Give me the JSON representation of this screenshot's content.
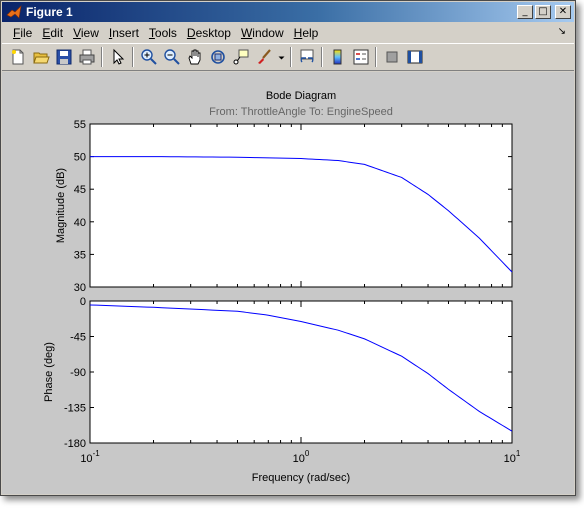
{
  "window": {
    "title": "Figure 1",
    "minimize_glyph": "_",
    "maximize_glyph": "□",
    "close_glyph": "✕"
  },
  "menubar": {
    "items": [
      {
        "label": "File",
        "accel": "F",
        "rest": "ile"
      },
      {
        "label": "Edit",
        "accel": "E",
        "rest": "dit"
      },
      {
        "label": "View",
        "accel": "V",
        "rest": "iew"
      },
      {
        "label": "Insert",
        "accel": "I",
        "rest": "nsert"
      },
      {
        "label": "Tools",
        "accel": "T",
        "rest": "ools"
      },
      {
        "label": "Desktop",
        "accel": "D",
        "rest": "esktop"
      },
      {
        "label": "Window",
        "accel": "W",
        "rest": "indow"
      },
      {
        "label": "Help",
        "accel": "H",
        "rest": "elp"
      }
    ],
    "dock_glyph": "↘"
  },
  "toolbar": {
    "tools": [
      "new-figure-icon",
      "open-file-icon",
      "save-icon",
      "print-icon",
      "edit-plot-arrow-icon",
      "zoom-in-icon",
      "zoom-out-icon",
      "pan-hand-icon",
      "rotate-3d-icon",
      "data-cursor-icon",
      "brush-icon",
      "dropdown-arrow-icon",
      "link-plot-icon",
      "insert-colorbar-icon",
      "insert-legend-icon",
      "hide-plot-tools-icon",
      "show-plot-tools-icon"
    ]
  },
  "colors": {
    "title_start": "#0a246a",
    "figure_bg": "#c8c8c8",
    "axes_bg": "#ffffff",
    "line": "#0000ff",
    "subtitle": "#666666"
  },
  "chart_data": [
    {
      "type": "line",
      "title": "Bode Diagram",
      "subtitle": "From: ThrottleAngle  To: EngineSpeed",
      "xlabel": "",
      "ylabel": "Magnitude (dB)",
      "xscale": "log",
      "xlim": [
        0.1,
        10
      ],
      "ylim": [
        30,
        55
      ],
      "yticks": [
        30,
        35,
        40,
        45,
        50,
        55
      ],
      "grid": false,
      "series": [
        {
          "x": [
            0.1,
            0.2,
            0.5,
            1.0,
            1.5,
            2.0,
            3.0,
            4.0,
            5.0,
            7.0,
            10.0
          ],
          "y": [
            50.0,
            50.0,
            49.9,
            49.7,
            49.4,
            48.8,
            46.8,
            44.2,
            41.7,
            37.5,
            32.3
          ]
        }
      ]
    },
    {
      "type": "line",
      "xlabel": "Frequency  (rad/sec)",
      "ylabel": "Phase (deg)",
      "xscale": "log",
      "xlim": [
        0.1,
        10
      ],
      "ylim": [
        -180,
        0
      ],
      "yticks": [
        0,
        -45,
        -90,
        -135,
        -180
      ],
      "xticks": [
        0.1,
        1,
        10
      ],
      "xtick_labels": [
        {
          "base": "10",
          "exp": "-1"
        },
        {
          "base": "10",
          "exp": "0"
        },
        {
          "base": "10",
          "exp": "1"
        }
      ],
      "grid": false,
      "series": [
        {
          "x": [
            0.1,
            0.2,
            0.5,
            0.7,
            1.0,
            1.5,
            2.0,
            3.0,
            4.0,
            5.0,
            7.0,
            10.0
          ],
          "y": [
            -5,
            -8,
            -13,
            -18,
            -26,
            -37,
            -48,
            -70,
            -92,
            -112,
            -140,
            -165
          ]
        }
      ]
    }
  ]
}
